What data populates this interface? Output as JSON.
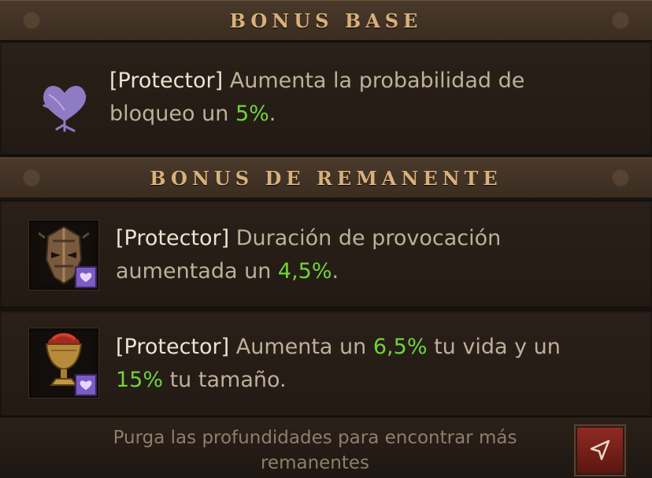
{
  "sections": {
    "base_title": "BONUS BASE",
    "remnant_title": "BONUS DE REMANENTE"
  },
  "base_bonus": {
    "icon": "heart-branch-icon",
    "tag": "[Protector]",
    "text_before": " Aumenta la probabilidad de bloqueo un ",
    "value": "5%",
    "text_after": "."
  },
  "remnant_items": [
    {
      "icon": "mask-icon",
      "badge_icon": "heart-icon",
      "tag": "[Protector]",
      "text_before": " Duración de provocación aumentada un ",
      "value": "4,5%",
      "text_after": "."
    },
    {
      "icon": "chalice-icon",
      "badge_icon": "heart-icon",
      "tag": "[Protector]",
      "text_before": " Aumenta un ",
      "value": "6,5%",
      "text_middle": " tu vida y un ",
      "value2": "15%",
      "text_after": " tu tamaño."
    }
  ],
  "footer": {
    "text": "Purga las profundidades para encontrar más remanentes",
    "button_icon": "map-pointer-icon"
  },
  "colors": {
    "accent_gold": "#d9b07a",
    "value_green": "#6fd43a",
    "badge_purple": "#7b5bc4"
  }
}
